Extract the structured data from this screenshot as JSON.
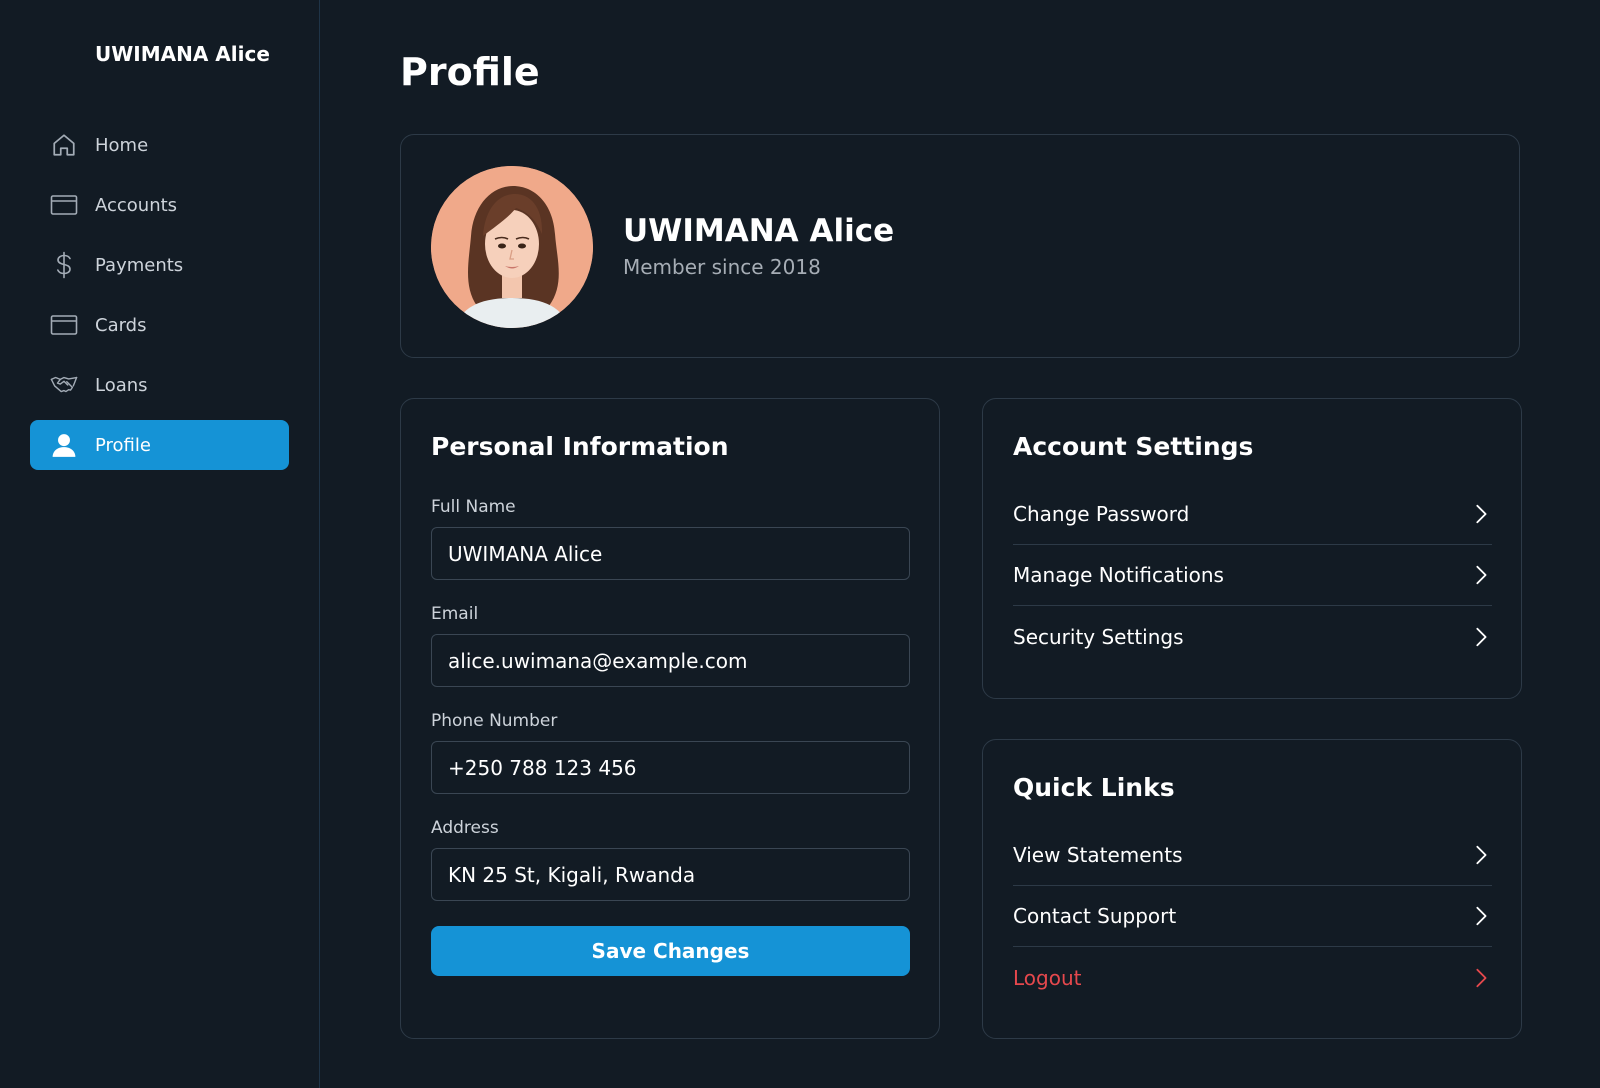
{
  "sidebar": {
    "user_name": "UWIMANA Alice",
    "items": [
      {
        "label": "Home",
        "icon": "home-icon"
      },
      {
        "label": "Accounts",
        "icon": "wallet-icon"
      },
      {
        "label": "Payments",
        "icon": "dollar-icon"
      },
      {
        "label": "Cards",
        "icon": "card-icon"
      },
      {
        "label": "Loans",
        "icon": "handshake-icon"
      },
      {
        "label": "Profile",
        "icon": "user-icon",
        "active": true
      }
    ]
  },
  "page": {
    "title": "Profile"
  },
  "profile": {
    "name": "UWIMANA Alice",
    "member_since": "Member since 2018"
  },
  "personal_info": {
    "title": "Personal Information",
    "fields": [
      {
        "label": "Full Name",
        "value": "UWIMANA Alice"
      },
      {
        "label": "Email",
        "value": "alice.uwimana@example.com"
      },
      {
        "label": "Phone Number",
        "value": "+250 788 123 456"
      },
      {
        "label": "Address",
        "value": "KN 25 St, Kigali, Rwanda"
      }
    ],
    "save_label": "Save Changes"
  },
  "account_settings": {
    "title": "Account Settings",
    "items": [
      {
        "label": "Change Password"
      },
      {
        "label": "Manage Notifications"
      },
      {
        "label": "Security Settings"
      }
    ]
  },
  "quick_links": {
    "title": "Quick Links",
    "items": [
      {
        "label": "View Statements"
      },
      {
        "label": "Contact Support"
      },
      {
        "label": "Logout",
        "danger": true
      }
    ]
  },
  "colors": {
    "background": "#121b24",
    "accent": "#1593d6",
    "danger": "#e5484d",
    "border": "#2d3a47"
  }
}
